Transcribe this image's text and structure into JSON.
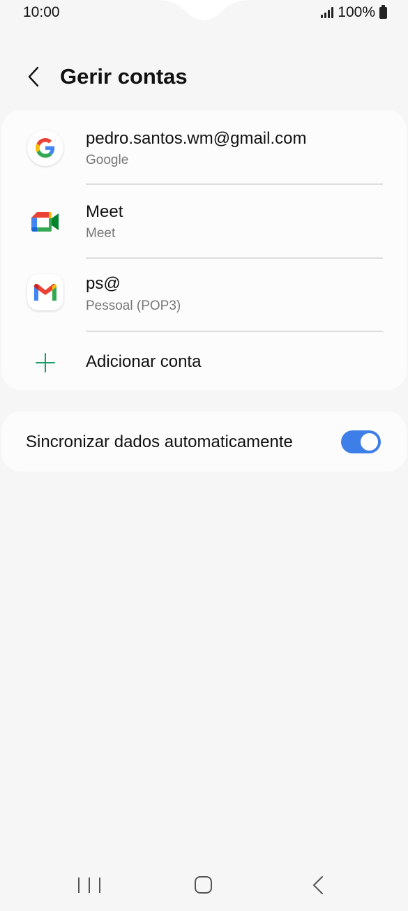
{
  "status_bar": {
    "time": "10:00",
    "battery": "100%"
  },
  "header": {
    "title": "Gerir contas",
    "back_icon": "chevron-left-icon"
  },
  "accounts": [
    {
      "name": "pedro.santos.wm@gmail.com",
      "type": "Google",
      "icon": "google-icon"
    },
    {
      "name": "Meet",
      "type": "Meet",
      "icon": "meet-icon"
    },
    {
      "name": "ps@",
      "type": "Pessoal (POP3)",
      "icon": "gmail-icon"
    }
  ],
  "add_account": {
    "label": "Adicionar conta",
    "icon": "plus-icon"
  },
  "sync": {
    "label": "Sincronizar dados automaticamente",
    "enabled": true
  },
  "colors": {
    "accent_toggle": "#3e7ee8",
    "add_icon": "#1a9e6a",
    "background": "#f6f6f6",
    "card": "#fcfcfc"
  },
  "navbar": {
    "recents_icon": "recents-icon",
    "home_icon": "home-icon",
    "back_icon": "back-icon"
  }
}
